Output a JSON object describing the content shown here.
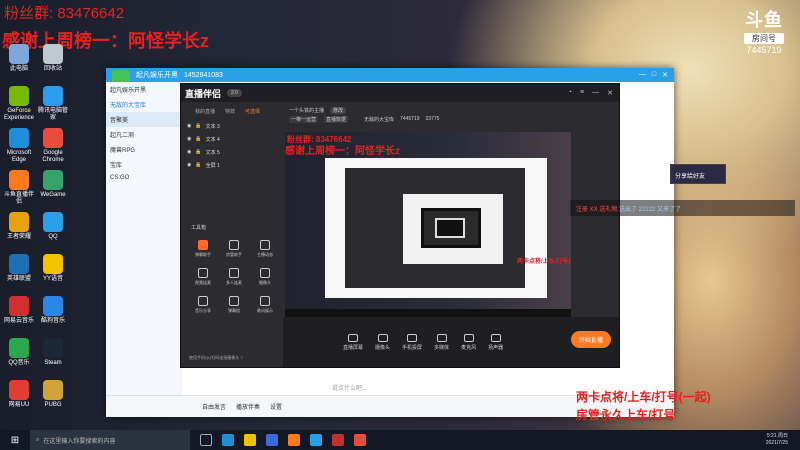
{
  "overlay": {
    "line1": "粉丝群: 83476642",
    "line2": "感谢上周榜一：阿怪学长z"
  },
  "watermark": {
    "logo": "斗鱼",
    "tag": "房间号",
    "room_no": "7445719"
  },
  "desktop_icons": [
    {
      "label": "此电脑",
      "color": "#7fa8d8"
    },
    {
      "label": "回收站",
      "color": "#c0c8d0"
    },
    {
      "label": "GeForce Experience",
      "color": "#76b900"
    },
    {
      "label": "腾讯电脑管家",
      "color": "#2b9cf0"
    },
    {
      "label": "Microsoft Edge",
      "color": "#1f8ed8"
    },
    {
      "label": "Google Chrome",
      "color": "#e74c3c"
    },
    {
      "label": "斗鱼直播伴侣",
      "color": "#ff7a1e"
    },
    {
      "label": "WeGame",
      "color": "#37a36b"
    },
    {
      "label": "王者荣耀",
      "color": "#e6a10d"
    },
    {
      "label": "QQ",
      "color": "#2aa0e8"
    },
    {
      "label": "英雄联盟",
      "color": "#1c6fb0"
    },
    {
      "label": "YY语音",
      "color": "#f2c200"
    },
    {
      "label": "网易云音乐",
      "color": "#d23030"
    },
    {
      "label": "酷狗音乐",
      "color": "#2a87e8"
    },
    {
      "label": "QQ音乐",
      "color": "#2ba84a"
    },
    {
      "label": "Steam",
      "color": "#1b2838"
    },
    {
      "label": "网易UU",
      "color": "#e03c31"
    },
    {
      "label": "PUBG",
      "color": "#d2a23a"
    }
  ],
  "main_window": {
    "title": "起凡娱乐开黑",
    "id_text": "1452841083",
    "left_items": [
      "起凡娱乐开黑",
      "无敌的大宝库",
      "音聚美",
      "起凡二测",
      "魔兽RPG",
      "宝库",
      "CS:GO"
    ],
    "chat_placeholder": "说点什么吧...",
    "bottom_items": [
      "自由发言",
      "播放伴奏",
      "设置"
    ]
  },
  "app": {
    "brand": "直播伴侣",
    "version": "2.0",
    "tabs": [
      "我的直播",
      "特效",
      "可选择"
    ],
    "scenes": [
      "文本 3",
      "文本 4",
      "文本 5",
      "全屏 1"
    ],
    "tools_title": "工具箱",
    "tools": [
      "弹幕助手",
      "房管助手",
      "主播动态",
      "视频连麦",
      "多人连麦",
      "摄像头",
      "音乐分享",
      "弹幕组",
      "歌词展示"
    ],
    "footer_hint": "使用手机QQ扫码连接摄像头 ?",
    "header_name": "一个头铁的主播",
    "header_tag": "修改",
    "header_chips": [
      "一带一运营",
      "直播数据"
    ],
    "header_stats": [
      "无敌的大宝库",
      "7445719",
      "33775"
    ],
    "bottom_items": [
      "直播屏幕",
      "摄像头",
      "手机投屏",
      "多媒体",
      "麦克风",
      "扬声器"
    ],
    "start_label": "开始直播"
  },
  "preview": {
    "red1": "粉丝群: 83476642",
    "red2": "感谢上周榜一：阿怪学长z",
    "red3": "两卡点将/上车/打号(一"
  },
  "gift_bar": {
    "text1": "注册 XX 送礼物",
    "text2": "送出了 22222 又来了了"
  },
  "side_button": "分享给好友",
  "bottom_red": {
    "line1": "两卡点将/上车/打号(一起)",
    "line2": "房管永久上车/打号"
  },
  "taskbar": {
    "search_placeholder": "在这里输入你要搜索的内容",
    "time": "5:21 周日",
    "date": "2021/7/25"
  }
}
